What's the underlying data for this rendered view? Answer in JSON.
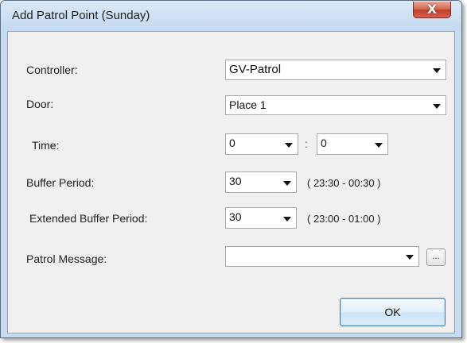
{
  "window": {
    "title": "Add Patrol Point (Sunday)",
    "close_glyph": "X"
  },
  "form": {
    "controller": {
      "label": "Controller:",
      "value": "GV-Patrol"
    },
    "door": {
      "label": "Door:",
      "value": "Place 1"
    },
    "time": {
      "label": "Time:",
      "hour": "0",
      "separator": ":",
      "minute": "0"
    },
    "buffer_period": {
      "label": "Buffer Period:",
      "value": "30",
      "range": "( 23:30 - 00:30 )"
    },
    "extended_buffer_period": {
      "label": "Extended Buffer Period:",
      "value": "30",
      "range": "( 23:00 - 01:00 )"
    },
    "patrol_message": {
      "label": "Patrol Message:",
      "value": "",
      "browse_label": "..."
    }
  },
  "buttons": {
    "ok_label": "OK"
  },
  "colors": {
    "frame": "#c7dcf0",
    "client_bg": "#f0f0f0",
    "close_red": "#c2402b",
    "ok_border": "#3c7fb1"
  },
  "icons": {
    "close": "close-icon",
    "dropdown": "chevron-down-icon"
  }
}
